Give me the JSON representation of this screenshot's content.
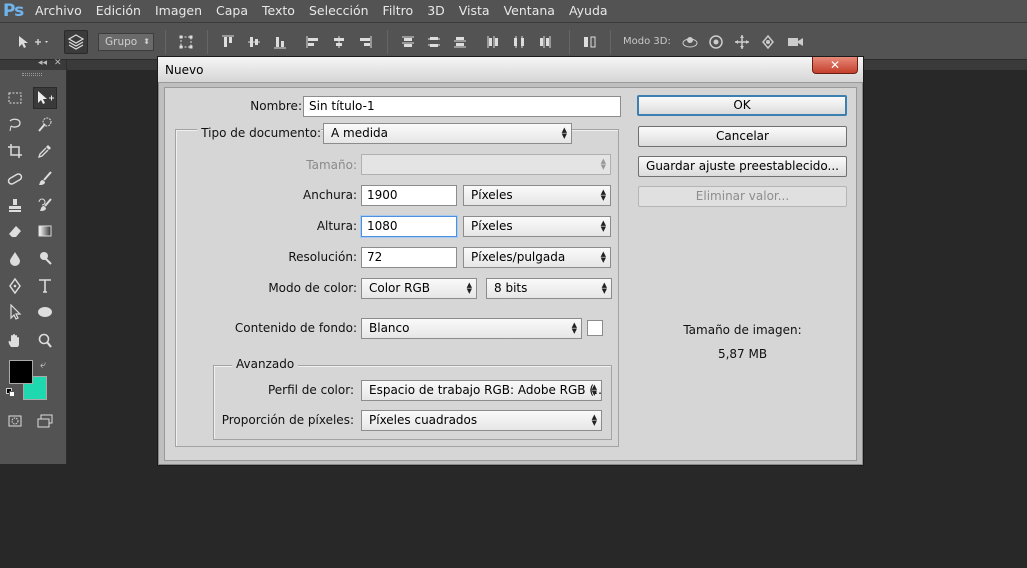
{
  "app": {
    "logo": "Ps",
    "menu": [
      "Archivo",
      "Edición",
      "Imagen",
      "Capa",
      "Texto",
      "Selección",
      "Filtro",
      "3D",
      "Vista",
      "Ventana",
      "Ayuda"
    ]
  },
  "options_bar": {
    "group_select": "Grupo",
    "mode3d_label": "Modo 3D:"
  },
  "toolbox": {
    "foreground_color": "#000000",
    "background_color": "#1fd8b0"
  },
  "dialog": {
    "title": "Nuevo",
    "close_glyph": "✕",
    "name_label": "Nombre:",
    "name_value": "Sin título-1",
    "doc_type_label": "Tipo de documento:",
    "doc_type_value": "A medida",
    "size_label": "Tamaño:",
    "size_value": "",
    "width_label": "Anchura:",
    "width_value": "1900",
    "width_unit": "Píxeles",
    "height_label": "Altura:",
    "height_value": "1080",
    "height_unit": "Píxeles",
    "resolution_label": "Resolución:",
    "resolution_value": "72",
    "resolution_unit": "Píxeles/pulgada",
    "color_mode_label": "Modo de color:",
    "color_mode_value": "Color RGB",
    "bit_depth_value": "8 bits",
    "background_label": "Contenido de fondo:",
    "background_value": "Blanco",
    "advanced_title": "Avanzado",
    "color_profile_label": "Perfil de color:",
    "color_profile_value": "Espacio de trabajo RGB: Adobe RGB (…",
    "pixel_aspect_label": "Proporción de píxeles:",
    "pixel_aspect_value": "Píxeles cuadrados",
    "ok_label": "OK",
    "cancel_label": "Cancelar",
    "save_preset_label": "Guardar ajuste preestablecido...",
    "delete_preset_label": "Eliminar valor...",
    "image_size_label": "Tamaño de imagen:",
    "image_size_value": "5,87 MB"
  }
}
